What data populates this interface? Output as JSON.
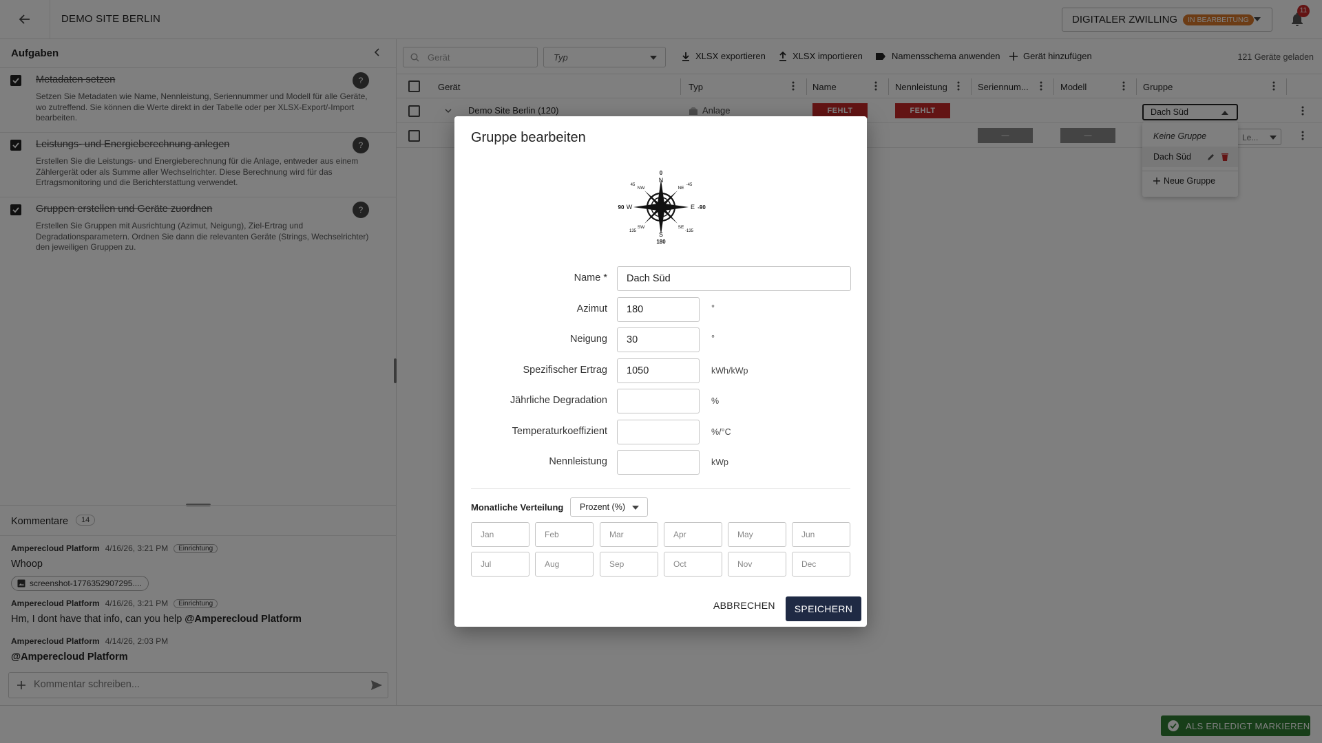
{
  "header": {
    "title": "DEMO SITE BERLIN",
    "twin_label": "DIGITALER ZWILLING",
    "twin_badge": "IN BEARBEITUNG",
    "notification_count": "11"
  },
  "tasks": {
    "title": "Aufgaben",
    "items": [
      {
        "title": "Metadaten setzen",
        "desc": "Setzen Sie Metadaten wie Name, Nennleistung, Seriennummer und Modell für alle Geräte, wo zutreffend. Sie können die Werte direkt in der Tabelle oder per XLSX-Export/-Import bearbeiten.",
        "help": "?"
      },
      {
        "title": "Leistungs- und Energieberechnung anlegen",
        "desc": "Erstellen Sie die Leistungs- und Energieberechnung für die Anlage, entweder aus einem Zählergerät oder als Summe aller Wechselrichter. Diese Berechnung wird für das Ertragsmonitoring und die Berichterstattung verwendet.",
        "help": "?"
      },
      {
        "title": "Gruppen erstellen und Geräte zuordnen",
        "desc": "Erstellen Sie Gruppen mit Ausrichtung (Azimut, Neigung), Ziel-Ertrag und Degradationsparametern. Ordnen Sie dann die relevanten Geräte (Strings, Wechselrichter) den jeweiligen Gruppen zu.",
        "help": "?"
      }
    ]
  },
  "comments": {
    "title": "Kommentare",
    "count": "14",
    "items": [
      {
        "author": "Amperecloud Platform",
        "date": "4/16/26, 3:21 PM",
        "tag": "Einrichtung",
        "text": "Whoop"
      },
      {
        "author": "Amperecloud Platform",
        "date": "4/16/26, 3:21 PM",
        "tag": "Einrichtung",
        "text": "Hm, I dont have that info, can you help ",
        "mention": "@Amperecloud Platform"
      },
      {
        "author": "Amperecloud Platform",
        "date": "4/14/26, 2:03 PM",
        "tag": "",
        "text": "@Amperecloud Platform"
      }
    ],
    "attachment": "screenshot-1776352907295....",
    "input_placeholder": "Kommentar schreiben..."
  },
  "toolbar": {
    "search_placeholder": "Gerät",
    "type_placeholder": "Typ",
    "export_label": "XLSX exportieren",
    "import_label": "XLSX importieren",
    "naming_label": "Namensschema anwenden",
    "add_label": "Gerät hinzufügen",
    "loaded": "121 Geräte geladen"
  },
  "table": {
    "columns": [
      "Gerät",
      "Typ",
      "Name",
      "Nennleistung",
      "Seriennum...",
      "Modell",
      "Gruppe"
    ],
    "rows": [
      {
        "device": "Demo Site Berlin (120)",
        "type": "Anlage",
        "name": "FEHLT",
        "power": "FEHLT",
        "group": "Dach Süd"
      },
      {
        "serial": "—",
        "model": "—",
        "group": "Le..."
      }
    ]
  },
  "group_dropdown": {
    "none": "Keine Gruppe",
    "selected": "Dach Süd",
    "new": "Neue Gruppe"
  },
  "modal": {
    "title": "Gruppe bearbeiten",
    "compass": {
      "n": "N",
      "e": "E",
      "s": "S",
      "w": "W",
      "ne": "NE",
      "nw": "NW",
      "se": "SE",
      "sw": "SW",
      "deg_n": "0",
      "deg_e": "-90",
      "deg_s": "180",
      "deg_w": "90",
      "deg_ne": "-45",
      "deg_nw": "45",
      "deg_se": "-135",
      "deg_sw": "135"
    },
    "fields": {
      "name": {
        "label": "Name *",
        "value": "Dach Süd"
      },
      "azimuth": {
        "label": "Azimut",
        "value": "180",
        "unit": "°"
      },
      "tilt": {
        "label": "Neigung",
        "value": "30",
        "unit": "°"
      },
      "specific_yield": {
        "label": "Spezifischer Ertrag",
        "value": "1050",
        "unit": "kWh/kWp"
      },
      "degradation": {
        "label": "Jährliche Degradation",
        "value": "",
        "unit": "%"
      },
      "temp_coeff": {
        "label": "Temperaturkoeffizient",
        "value": "",
        "unit": "%/°C"
      },
      "nominal_power": {
        "label": "Nennleistung",
        "value": "",
        "unit": "kWp"
      }
    },
    "monthly_label": "Monatliche Verteilung",
    "monthly_mode": "Prozent (%)",
    "months": [
      "Jan",
      "Feb",
      "Mar",
      "Apr",
      "May",
      "Jun",
      "Jul",
      "Aug",
      "Sep",
      "Oct",
      "Nov",
      "Dec"
    ],
    "cancel": "ABBRECHEN",
    "save": "SPEICHERN"
  },
  "bottom": {
    "done_label": "ALS ERLEDIGT MARKIEREN"
  }
}
